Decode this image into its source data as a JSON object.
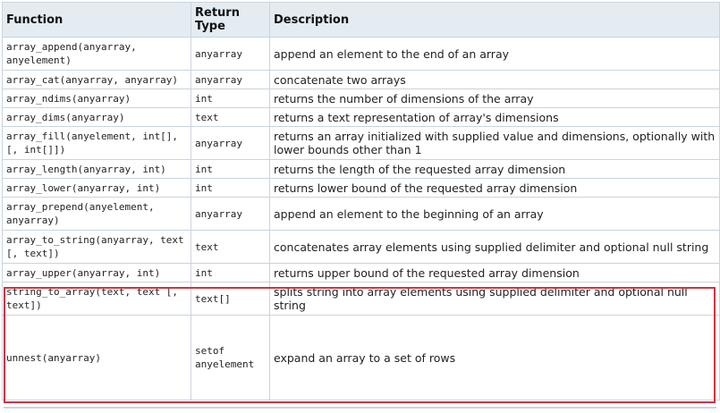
{
  "table": {
    "headers": {
      "function": "Function",
      "return_type": "Return Type",
      "description": "Description"
    },
    "rows": [
      {
        "function": "array_append(anyarray, anyelement)",
        "return_type": "anyarray",
        "description": "append an element to the end of an array"
      },
      {
        "function": "array_cat(anyarray, anyarray)",
        "return_type": "anyarray",
        "description": "concatenate two arrays"
      },
      {
        "function": "array_ndims(anyarray)",
        "return_type": "int",
        "description": "returns the number of dimensions of the array"
      },
      {
        "function": "array_dims(anyarray)",
        "return_type": "text",
        "description": "returns a text representation of array's dimensions"
      },
      {
        "function": "array_fill(anyelement, int[], [, int[]])",
        "return_type": "anyarray",
        "description": "returns an array initialized with supplied value and dimensions, optionally with lower bounds other than 1"
      },
      {
        "function": "array_length(anyarray, int)",
        "return_type": "int",
        "description": "returns the length of the requested array dimension"
      },
      {
        "function": "array_lower(anyarray, int)",
        "return_type": "int",
        "description": "returns lower bound of the requested array dimension"
      },
      {
        "function": "array_prepend(anyelement, anyarray)",
        "return_type": "anyarray",
        "description": "append an element to the beginning of an array"
      },
      {
        "function": "array_to_string(anyarray, text [, text])",
        "return_type": "text",
        "description": "concatenates array elements using supplied delimiter and optional null string"
      },
      {
        "function": "array_upper(anyarray, int)",
        "return_type": "int",
        "description": "returns upper bound of the requested array dimension"
      },
      {
        "function": "string_to_array(text, text [, text])",
        "return_type": "text[]",
        "description": "splits string into array elements using supplied delimiter and optional null string"
      },
      {
        "function": "unnest(anyarray)",
        "return_type": "setof anyelement",
        "description": "expand an array to a set of rows"
      }
    ]
  },
  "highlight_color": "#d9303d",
  "header_bg": "#e4ecf2",
  "border_color": "#c9d4dd"
}
